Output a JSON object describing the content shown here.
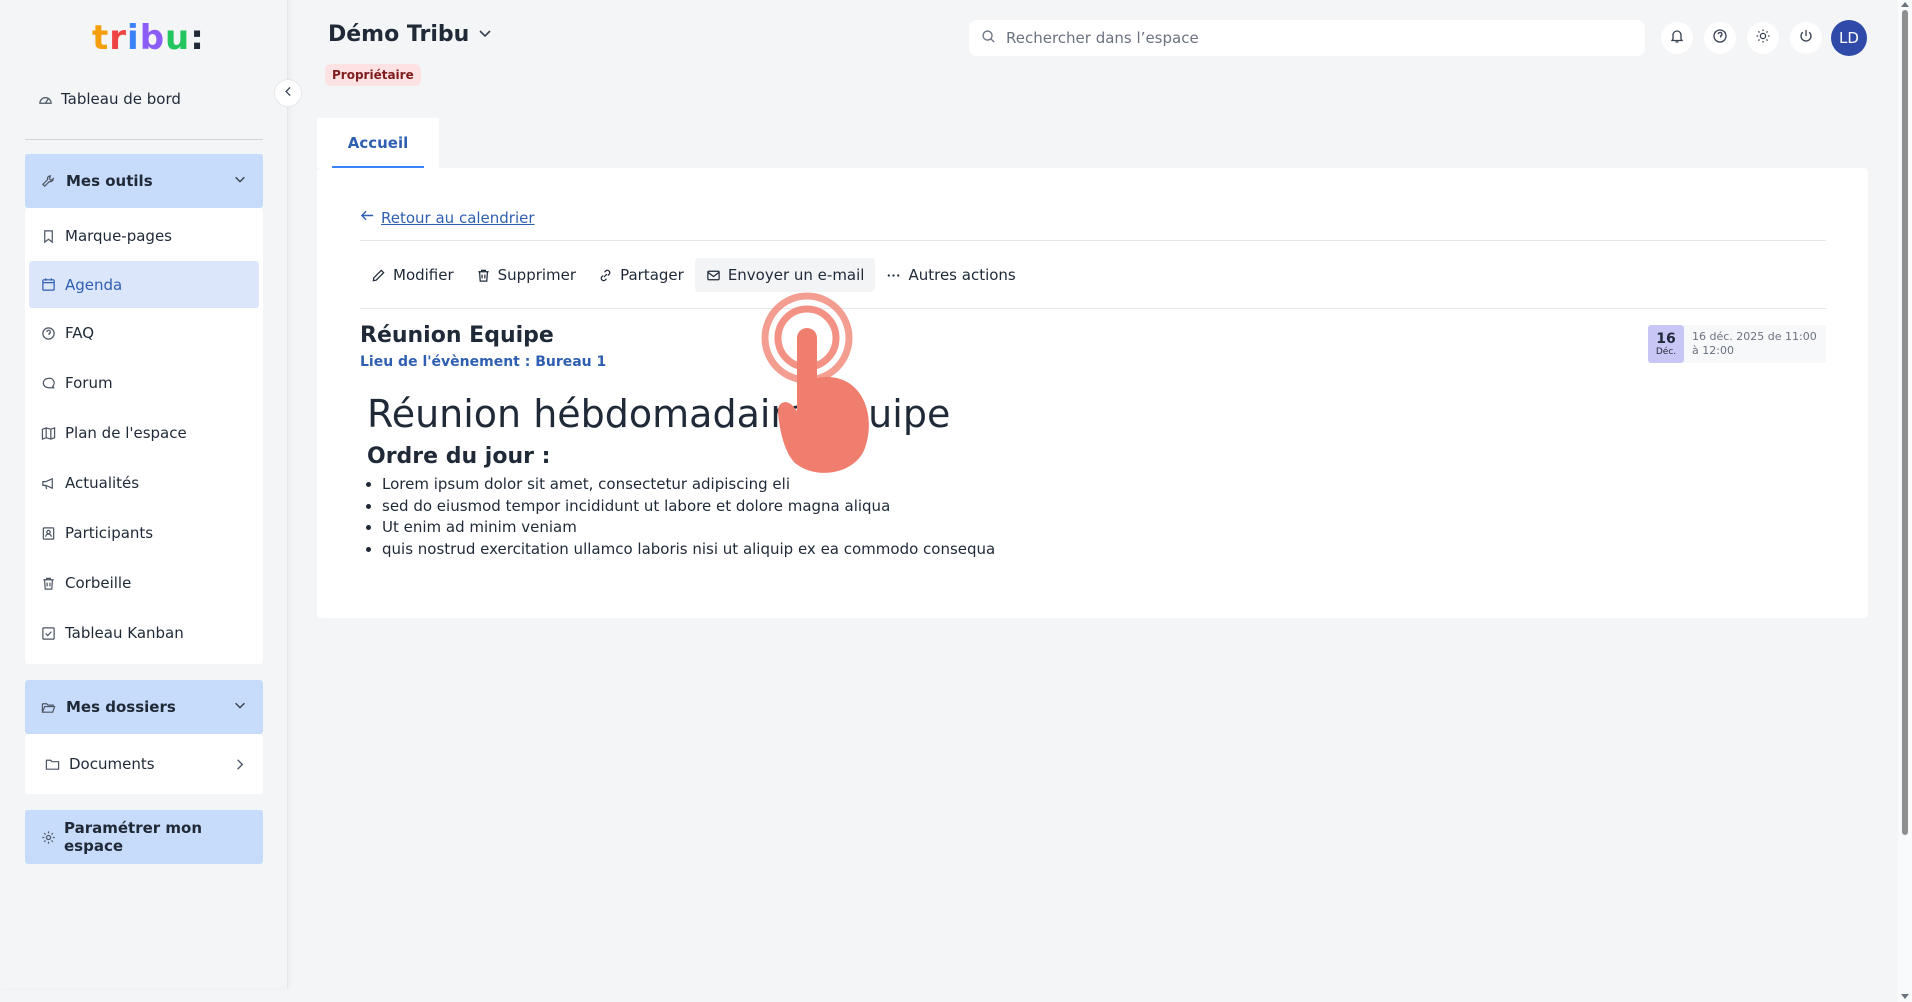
{
  "logo": {
    "letters": [
      "t",
      "r",
      "i",
      "b",
      "u",
      ":"
    ],
    "colors": [
      "#f59e0b",
      "#ef4444",
      "#3b82f6",
      "#8b5cf6",
      "#22c55e",
      "#1f2937"
    ]
  },
  "sidebar": {
    "dashboard_label": "Tableau de bord",
    "tools_group": {
      "label": "Mes outils",
      "icon": "wrench-icon"
    },
    "tools_items": [
      {
        "label": "Marque-pages",
        "icon": "bookmark-icon"
      },
      {
        "label": "Agenda",
        "icon": "calendar-icon",
        "active": true
      },
      {
        "label": "FAQ",
        "icon": "question-icon"
      },
      {
        "label": "Forum",
        "icon": "chat-icon"
      },
      {
        "label": "Plan de l'espace",
        "icon": "map-icon"
      },
      {
        "label": "Actualités",
        "icon": "megaphone-icon"
      },
      {
        "label": "Participants",
        "icon": "contacts-icon"
      },
      {
        "label": "Corbeille",
        "icon": "trash-icon"
      },
      {
        "label": "Tableau Kanban",
        "icon": "checkbox-icon"
      }
    ],
    "folders_group": {
      "label": "Mes dossiers",
      "icon": "folder-open-icon"
    },
    "folders_items": [
      {
        "label": "Documents",
        "icon": "folder-icon"
      }
    ],
    "settings_label": "Paramétrer mon espace"
  },
  "header": {
    "space_title": "Démo Tribu",
    "role_badge": "Propriétaire",
    "search_placeholder": "Rechercher dans l’espace",
    "avatar_initials": "LD",
    "icons": [
      "bell-icon",
      "help-icon",
      "sun-icon",
      "power-icon"
    ]
  },
  "tabs": [
    {
      "label": "Accueil",
      "active": true
    }
  ],
  "event": {
    "back_link": "Retour au calendrier",
    "actions": [
      {
        "label": "Modifier",
        "icon": "pencil-icon"
      },
      {
        "label": "Supprimer",
        "icon": "trash-icon"
      },
      {
        "label": "Partager",
        "icon": "link-icon"
      },
      {
        "label": "Envoyer un e-mail",
        "icon": "mail-icon"
      },
      {
        "label": "Autres actions",
        "icon": "more-icon"
      }
    ],
    "title": "Réunion Equipe",
    "place": "Lieu de l'évènement : Bureau 1",
    "date_day": "16",
    "date_month": "Déc.",
    "date_text": "16 déc. 2025 de 11:00 à 12:00",
    "heading": "Réunion hébdomadaire équipe",
    "agenda_title": "Ordre du jour :",
    "agenda_items": [
      "Lorem ipsum dolor sit amet, consectetur adipiscing eli",
      "sed do eiusmod tempor incididunt ut labore et dolore magna aliqua",
      "Ut enim ad minim veniam",
      "quis nostrud exercitation ullamco laboris nisi ut aliquip ex ea commodo consequa"
    ]
  },
  "colors": {
    "accent": "#2f5fb0",
    "group_bg": "#c7dbfa",
    "active_bg": "#dbe6fb",
    "badge_bg": "#fde2e4",
    "avatar_bg": "#2f4aa8",
    "pointer": "#f07e6e"
  }
}
